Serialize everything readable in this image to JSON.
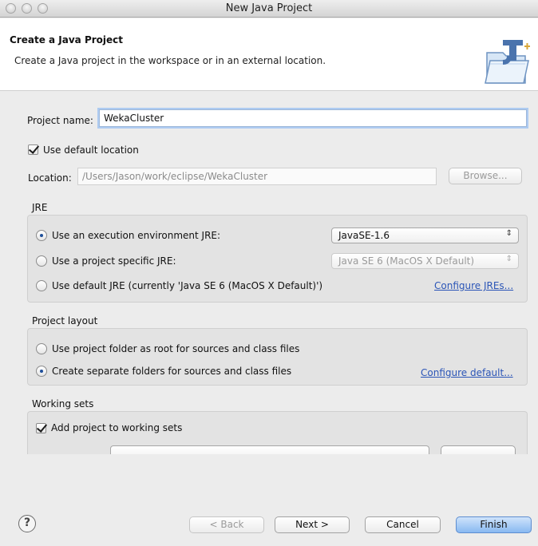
{
  "window": {
    "title": "New Java Project"
  },
  "header": {
    "title": "Create a Java Project",
    "description": "Create a Java project in the workspace or in an external location."
  },
  "project_name": {
    "label": "Project name:",
    "value": "WekaCluster"
  },
  "use_default_location": {
    "label": "Use default location",
    "checked": true
  },
  "location": {
    "label": "Location:",
    "value": "/Users/Jason/work/eclipse/WekaCluster",
    "browse_label": "Browse..."
  },
  "jre": {
    "group_label": "JRE",
    "option1": {
      "label": "Use an execution environment JRE:",
      "selected": true,
      "select_value": "JavaSE-1.6"
    },
    "option2": {
      "label": "Use a project specific JRE:",
      "selected": false,
      "select_value": "Java SE 6 (MacOS X Default)"
    },
    "option3": {
      "label": "Use default JRE (currently 'Java SE 6 (MacOS X Default)')",
      "selected": false
    },
    "configure_link": "Configure JREs..."
  },
  "project_layout": {
    "group_label": "Project layout",
    "option1": {
      "label": "Use project folder as root for sources and class files",
      "selected": false
    },
    "option2": {
      "label": "Create separate folders for sources and class files",
      "selected": true
    },
    "configure_link": "Configure default..."
  },
  "working_sets": {
    "group_label": "Working sets",
    "add_label": "Add project to working sets",
    "add_checked": true
  },
  "footer": {
    "help_icon": "?",
    "back_label": "< Back",
    "next_label": "Next >",
    "cancel_label": "Cancel",
    "finish_label": "Finish"
  },
  "colors": {
    "link": "#2b55b7",
    "focus_ring": "#aecbf1",
    "default_button": "#88b9f1"
  }
}
